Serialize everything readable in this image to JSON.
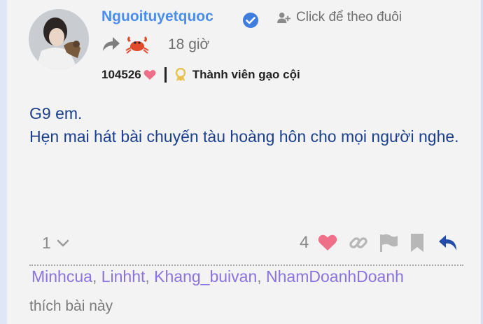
{
  "post": {
    "username": "Nguoituyetquoc",
    "follow_label": "Click để theo đuôi",
    "time": "18 giờ",
    "points": "104526",
    "rank": "Thành viên gạo cội",
    "body": [
      "G9 em.",
      "Hẹn mai hát bài chuyến tàu hoàng hôn cho mọi người nghe."
    ],
    "reply_count": "1",
    "like_count": "4",
    "likers": [
      "Minhcua",
      "Linhht",
      "Khang_buivan",
      "NhamDoanhDoanh"
    ],
    "liked_suffix": "thích bài này"
  },
  "colors": {
    "username": "#4a8df0",
    "body_text": "#1b3f8f",
    "liker_link": "#8a73e0",
    "heart": "#ee6f87",
    "reply_accent": "#234ea8",
    "verified": "#3e7ce0",
    "badge": "#e8c24d"
  },
  "icons": [
    "verified-badge-icon",
    "follow-user-icon",
    "share-icon",
    "crab-icon",
    "heart-icon",
    "badge-icon",
    "chevron-down-icon",
    "link-icon",
    "flag-icon",
    "bookmark-icon",
    "reply-icon"
  ]
}
